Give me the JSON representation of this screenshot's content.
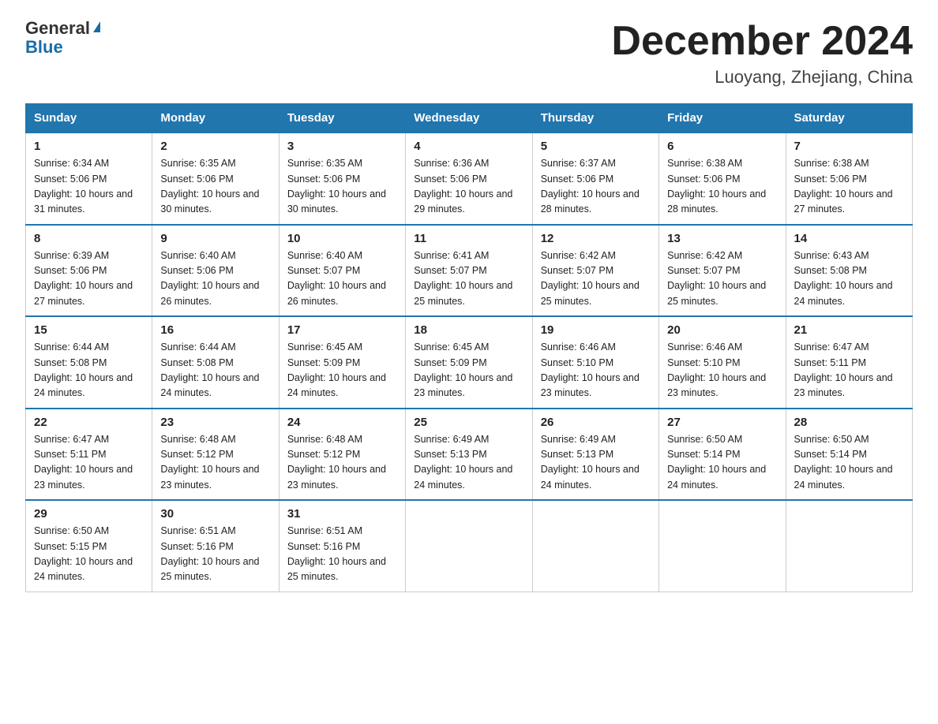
{
  "header": {
    "logo_general": "General",
    "logo_blue": "Blue",
    "month_title": "December 2024",
    "location": "Luoyang, Zhejiang, China"
  },
  "columns": [
    "Sunday",
    "Monday",
    "Tuesday",
    "Wednesday",
    "Thursday",
    "Friday",
    "Saturday"
  ],
  "weeks": [
    [
      {
        "day": "1",
        "sunrise": "6:34 AM",
        "sunset": "5:06 PM",
        "daylight": "10 hours and 31 minutes."
      },
      {
        "day": "2",
        "sunrise": "6:35 AM",
        "sunset": "5:06 PM",
        "daylight": "10 hours and 30 minutes."
      },
      {
        "day": "3",
        "sunrise": "6:35 AM",
        "sunset": "5:06 PM",
        "daylight": "10 hours and 30 minutes."
      },
      {
        "day": "4",
        "sunrise": "6:36 AM",
        "sunset": "5:06 PM",
        "daylight": "10 hours and 29 minutes."
      },
      {
        "day": "5",
        "sunrise": "6:37 AM",
        "sunset": "5:06 PM",
        "daylight": "10 hours and 28 minutes."
      },
      {
        "day": "6",
        "sunrise": "6:38 AM",
        "sunset": "5:06 PM",
        "daylight": "10 hours and 28 minutes."
      },
      {
        "day": "7",
        "sunrise": "6:38 AM",
        "sunset": "5:06 PM",
        "daylight": "10 hours and 27 minutes."
      }
    ],
    [
      {
        "day": "8",
        "sunrise": "6:39 AM",
        "sunset": "5:06 PM",
        "daylight": "10 hours and 27 minutes."
      },
      {
        "day": "9",
        "sunrise": "6:40 AM",
        "sunset": "5:06 PM",
        "daylight": "10 hours and 26 minutes."
      },
      {
        "day": "10",
        "sunrise": "6:40 AM",
        "sunset": "5:07 PM",
        "daylight": "10 hours and 26 minutes."
      },
      {
        "day": "11",
        "sunrise": "6:41 AM",
        "sunset": "5:07 PM",
        "daylight": "10 hours and 25 minutes."
      },
      {
        "day": "12",
        "sunrise": "6:42 AM",
        "sunset": "5:07 PM",
        "daylight": "10 hours and 25 minutes."
      },
      {
        "day": "13",
        "sunrise": "6:42 AM",
        "sunset": "5:07 PM",
        "daylight": "10 hours and 25 minutes."
      },
      {
        "day": "14",
        "sunrise": "6:43 AM",
        "sunset": "5:08 PM",
        "daylight": "10 hours and 24 minutes."
      }
    ],
    [
      {
        "day": "15",
        "sunrise": "6:44 AM",
        "sunset": "5:08 PM",
        "daylight": "10 hours and 24 minutes."
      },
      {
        "day": "16",
        "sunrise": "6:44 AM",
        "sunset": "5:08 PM",
        "daylight": "10 hours and 24 minutes."
      },
      {
        "day": "17",
        "sunrise": "6:45 AM",
        "sunset": "5:09 PM",
        "daylight": "10 hours and 24 minutes."
      },
      {
        "day": "18",
        "sunrise": "6:45 AM",
        "sunset": "5:09 PM",
        "daylight": "10 hours and 23 minutes."
      },
      {
        "day": "19",
        "sunrise": "6:46 AM",
        "sunset": "5:10 PM",
        "daylight": "10 hours and 23 minutes."
      },
      {
        "day": "20",
        "sunrise": "6:46 AM",
        "sunset": "5:10 PM",
        "daylight": "10 hours and 23 minutes."
      },
      {
        "day": "21",
        "sunrise": "6:47 AM",
        "sunset": "5:11 PM",
        "daylight": "10 hours and 23 minutes."
      }
    ],
    [
      {
        "day": "22",
        "sunrise": "6:47 AM",
        "sunset": "5:11 PM",
        "daylight": "10 hours and 23 minutes."
      },
      {
        "day": "23",
        "sunrise": "6:48 AM",
        "sunset": "5:12 PM",
        "daylight": "10 hours and 23 minutes."
      },
      {
        "day": "24",
        "sunrise": "6:48 AM",
        "sunset": "5:12 PM",
        "daylight": "10 hours and 23 minutes."
      },
      {
        "day": "25",
        "sunrise": "6:49 AM",
        "sunset": "5:13 PM",
        "daylight": "10 hours and 24 minutes."
      },
      {
        "day": "26",
        "sunrise": "6:49 AM",
        "sunset": "5:13 PM",
        "daylight": "10 hours and 24 minutes."
      },
      {
        "day": "27",
        "sunrise": "6:50 AM",
        "sunset": "5:14 PM",
        "daylight": "10 hours and 24 minutes."
      },
      {
        "day": "28",
        "sunrise": "6:50 AM",
        "sunset": "5:14 PM",
        "daylight": "10 hours and 24 minutes."
      }
    ],
    [
      {
        "day": "29",
        "sunrise": "6:50 AM",
        "sunset": "5:15 PM",
        "daylight": "10 hours and 24 minutes."
      },
      {
        "day": "30",
        "sunrise": "6:51 AM",
        "sunset": "5:16 PM",
        "daylight": "10 hours and 25 minutes."
      },
      {
        "day": "31",
        "sunrise": "6:51 AM",
        "sunset": "5:16 PM",
        "daylight": "10 hours and 25 minutes."
      },
      null,
      null,
      null,
      null
    ]
  ]
}
